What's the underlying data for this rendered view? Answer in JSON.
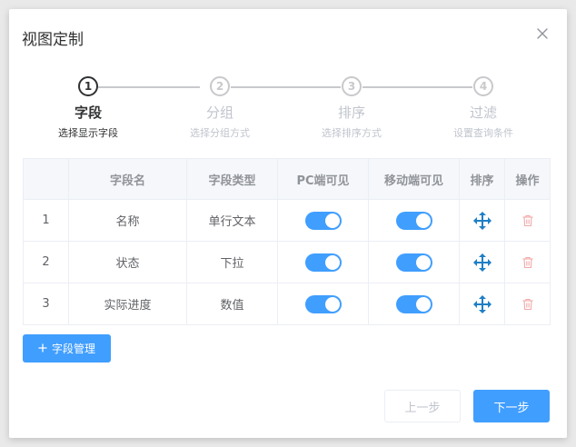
{
  "dialog": {
    "title": "视图定制",
    "close_icon": "close-icon"
  },
  "steps": [
    {
      "number": "1",
      "title": "字段",
      "desc": "选择显示字段",
      "active": true
    },
    {
      "number": "2",
      "title": "分组",
      "desc": "选择分组方式",
      "active": false
    },
    {
      "number": "3",
      "title": "排序",
      "desc": "选择排序方式",
      "active": false
    },
    {
      "number": "4",
      "title": "过滤",
      "desc": "设置查询条件",
      "active": false
    }
  ],
  "table": {
    "headers": [
      "",
      "字段名",
      "字段类型",
      "PC端可见",
      "移动端可见",
      "排序",
      "操作"
    ],
    "rows": [
      {
        "index": "1",
        "name": "名称",
        "type": "单行文本",
        "pc_visible": true,
        "mobile_visible": true
      },
      {
        "index": "2",
        "name": "状态",
        "type": "下拉",
        "pc_visible": true,
        "mobile_visible": true
      },
      {
        "index": "3",
        "name": "实际进度",
        "type": "数值",
        "pc_visible": true,
        "mobile_visible": true
      }
    ],
    "sort_icon": "move-icon",
    "delete_icon": "trash-icon"
  },
  "buttons": {
    "manage_label": "字段管理",
    "prev_label": "上一步",
    "next_label": "下一步"
  },
  "colors": {
    "primary": "#409eff",
    "move_icon": "#1f7fc5",
    "delete_icon": "#f3a9a9"
  }
}
